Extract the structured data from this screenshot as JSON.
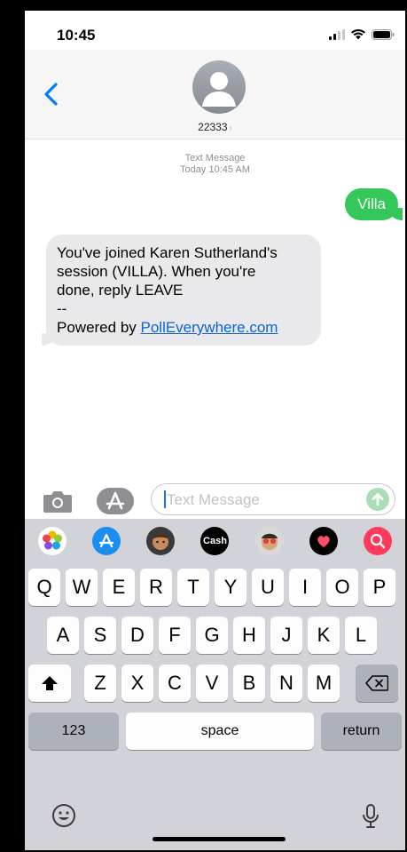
{
  "status_bar": {
    "time": "10:45"
  },
  "header": {
    "contact": "22333",
    "chevron": "›"
  },
  "messages": {
    "meta_line1": "Text Message",
    "meta_line2": "Today 10:45 AM",
    "outgoing": "Villa",
    "incoming_lines": [
      "You've joined Karen Sutherland's",
      "session (VILLA). When you're",
      "done, reply LEAVE",
      "--"
    ],
    "incoming_powered": "Powered by ",
    "incoming_link": "PollEverywhere.com"
  },
  "input": {
    "placeholder": "Text Message"
  },
  "app_strip": {
    "cash_label": "Cash"
  },
  "keyboard": {
    "row1": [
      "Q",
      "W",
      "E",
      "R",
      "T",
      "Y",
      "U",
      "I",
      "O",
      "P"
    ],
    "row2": [
      "A",
      "S",
      "D",
      "F",
      "G",
      "H",
      "J",
      "K",
      "L"
    ],
    "row3": [
      "Z",
      "X",
      "C",
      "V",
      "B",
      "N",
      "M"
    ],
    "numbers": "123",
    "space": "space",
    "return": "return"
  },
  "colors": {
    "outgoing_bubble": "#34c759",
    "incoming_bubble": "#e9e9eb",
    "link": "#0a64d6",
    "ios_blue": "#007aff"
  }
}
